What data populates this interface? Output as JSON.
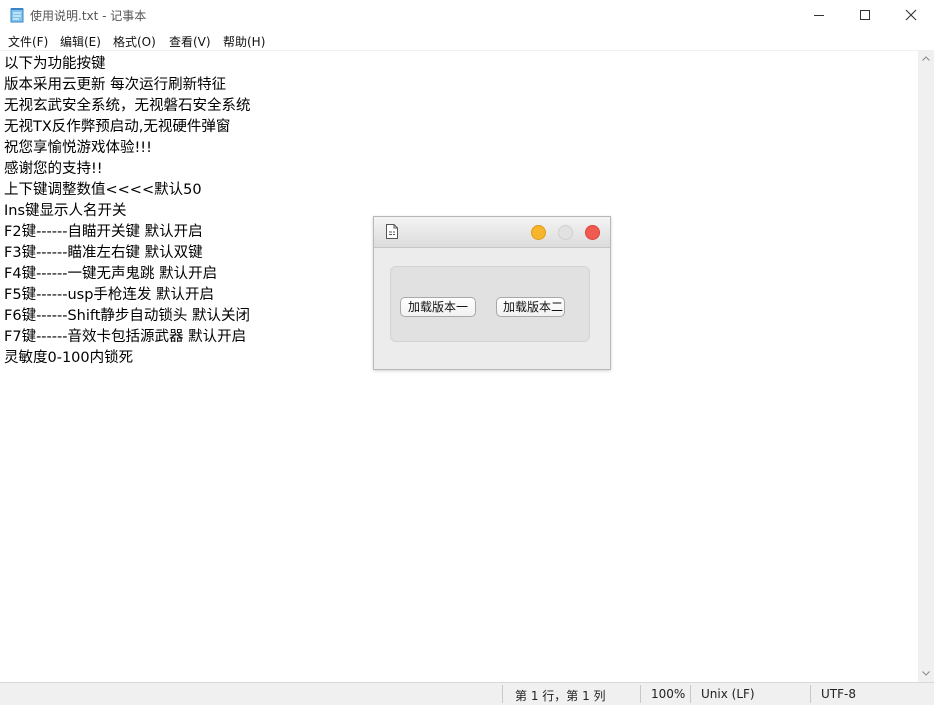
{
  "window": {
    "title": "使用说明.txt - 记事本"
  },
  "menu": {
    "items": [
      "文件(F)",
      "编辑(E)",
      "格式(O)",
      "查看(V)",
      "帮助(H)"
    ]
  },
  "editor": {
    "lines": [
      "以下为功能按键",
      "版本采用云更新 每次运行刷新特征",
      "无视玄武安全系统，无视磐石安全系统",
      "无视TX反作弊预启动,无视硬件弹窗",
      "祝您享愉悦游戏体验!!!",
      "感谢您的支持!!",
      "上下键调整数值<<<<默认50",
      "Ins键显示人名开关",
      "F2键------自瞄开关键 默认开启",
      "F3键------瞄准左右键 默认双键",
      "F4键------一键无声鬼跳 默认开启",
      "F5键------usp手枪连发 默认开启",
      "F6键------Shift静步自动锁头 默认关闭",
      "F7键------音效卡包括源武器 默认开启",
      "灵敏度0-100内锁死"
    ]
  },
  "statusbar": {
    "position": "第 1 行，第 1 列",
    "zoom": "100%",
    "line_ending": "Unix (LF)",
    "encoding": "UTF-8"
  },
  "dialog": {
    "button1_label": "加载版本一",
    "button2_label": "加载版本二",
    "traffic_colors": {
      "minimize": "#f6b52b",
      "disabled": "#e2e2e2",
      "close": "#f05a4f"
    }
  },
  "icons": {
    "app": "notepad-icon",
    "dialog": "document-icon",
    "minimize": "minimize-icon",
    "maximize": "maximize-icon",
    "close": "close-icon",
    "scroll_up": "chevron-up-icon",
    "scroll_down": "chevron-down-icon"
  }
}
